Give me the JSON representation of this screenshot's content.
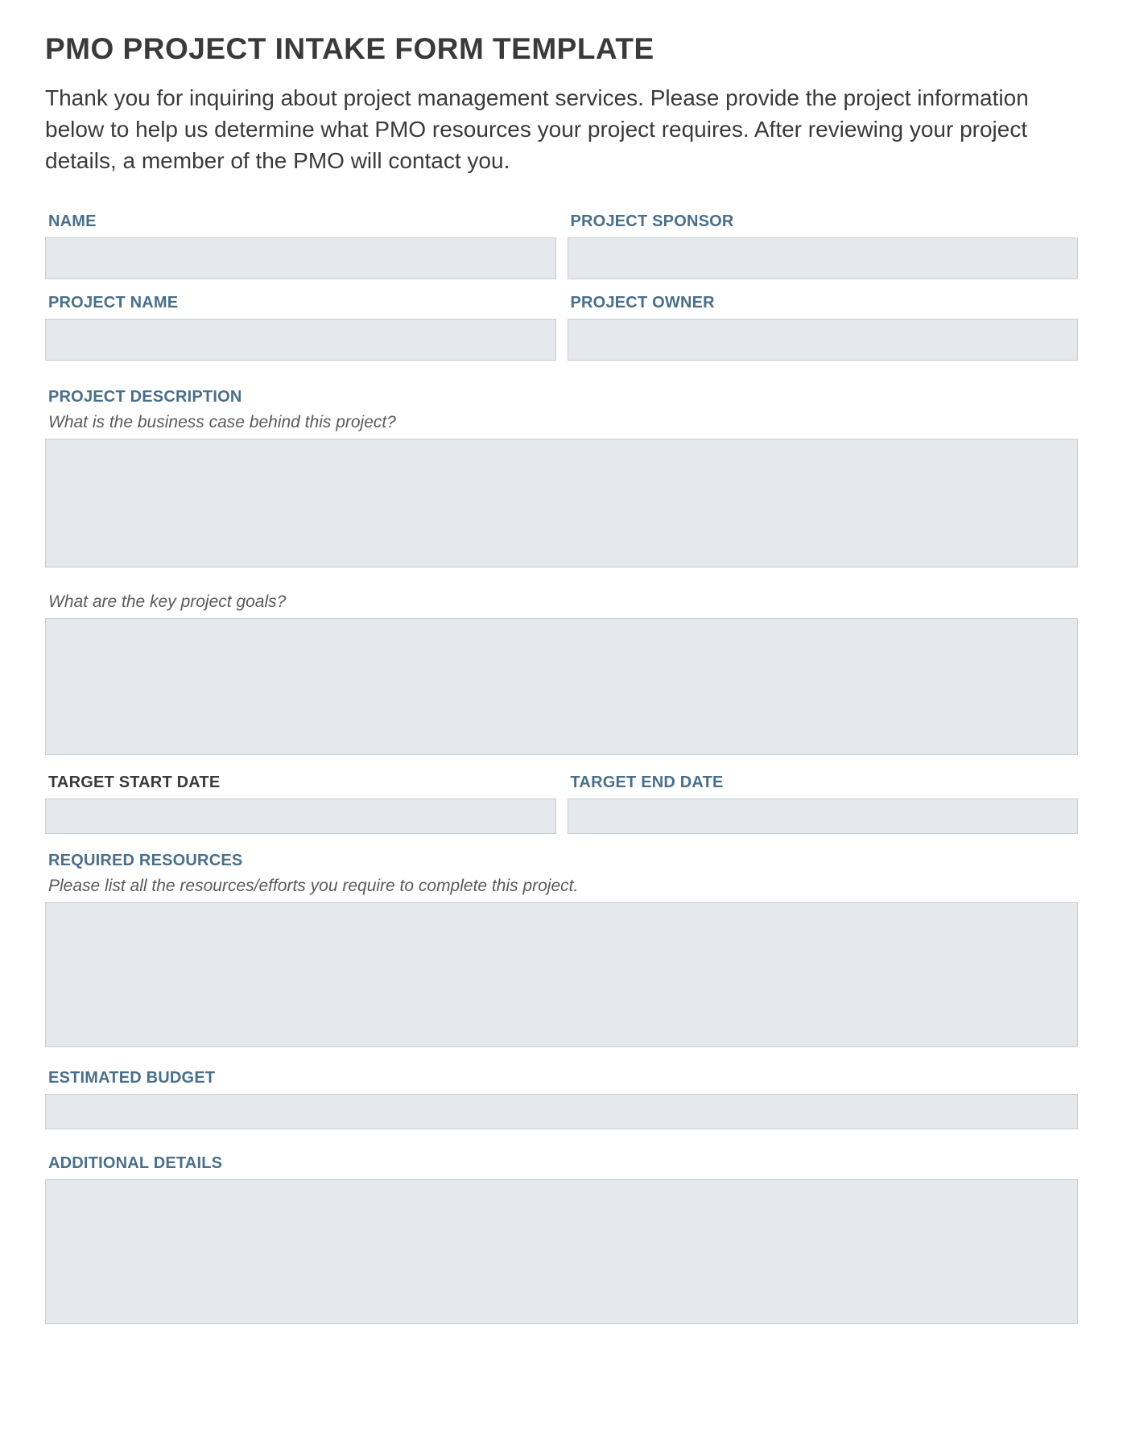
{
  "title": "PMO PROJECT INTAKE FORM TEMPLATE",
  "intro": "Thank you for inquiring about project management services. Please provide the project information below to help us determine what PMO resources your project requires. After reviewing your project details, a member of the PMO will contact you.",
  "labels": {
    "name": "NAME",
    "project_sponsor": "PROJECT SPONSOR",
    "project_name": "PROJECT NAME",
    "project_owner": "PROJECT OWNER",
    "project_description": "PROJECT DESCRIPTION",
    "target_start_date": "TARGET START DATE",
    "target_end_date": "TARGET END DATE",
    "required_resources": "REQUIRED RESOURCES",
    "estimated_budget": "ESTIMATED BUDGET",
    "additional_details": "ADDITIONAL DETAILS"
  },
  "hints": {
    "business_case": "What is the business case behind this project?",
    "key_goals": "What are the key project goals?",
    "resources": "Please list all the resources/efforts you require to complete this project."
  },
  "values": {
    "name": "",
    "project_sponsor": "",
    "project_name": "",
    "project_owner": "",
    "business_case": "",
    "key_goals": "",
    "target_start_date": "",
    "target_end_date": "",
    "required_resources": "",
    "estimated_budget": "",
    "additional_details": ""
  }
}
